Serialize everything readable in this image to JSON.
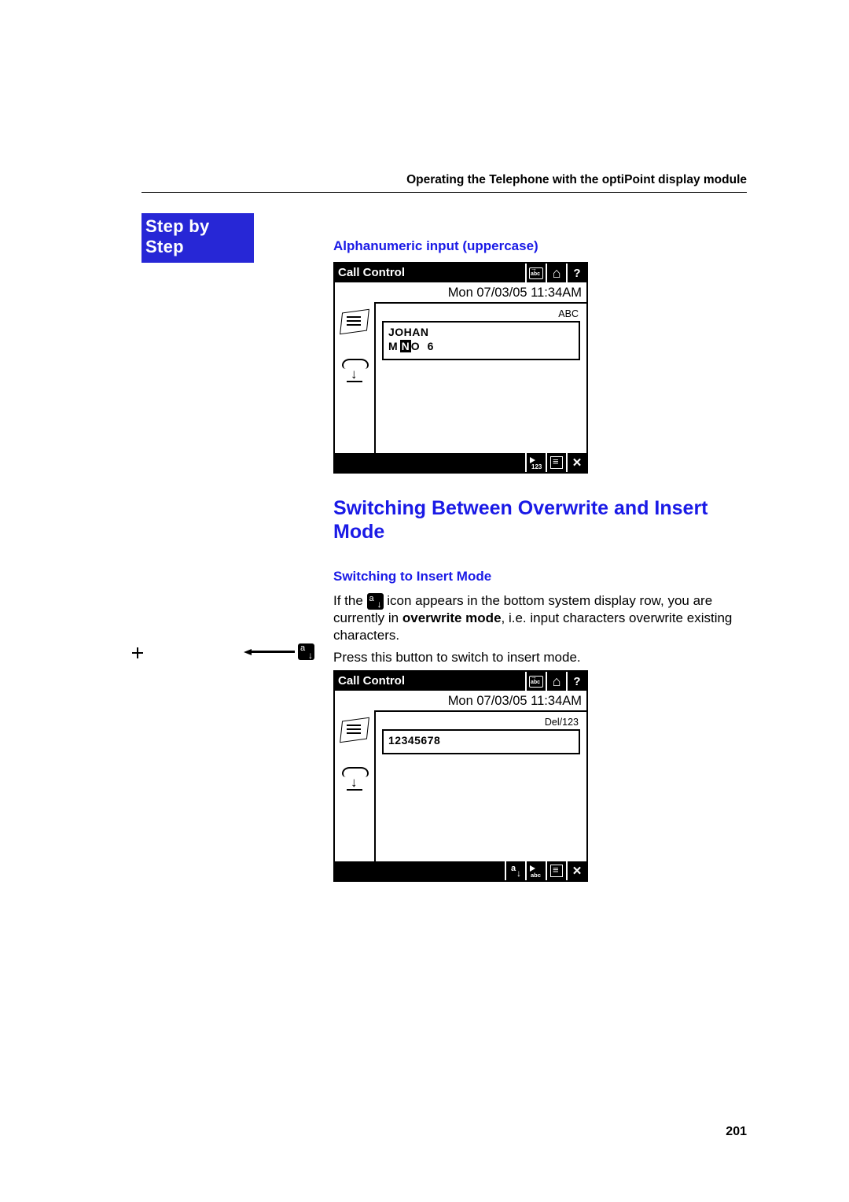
{
  "running_header": "Operating the Telephone with the optiPoint display module",
  "sidebar": {
    "step_label": "Step by Step"
  },
  "section1": {
    "label": "Alphanumeric input (uppercase)",
    "phone": {
      "title": "Call Control",
      "datetime": "Mon 07/03/05 11:34AM",
      "mode_indicator": "ABC",
      "line1": "JOHAN",
      "line2_pre": "M",
      "line2_cursor": "N",
      "line2_post": "O 6",
      "top_icons": [
        "keyboard-abc-icon",
        "home-icon",
        "help-icon"
      ],
      "bottom_icons": [
        "to-123-icon",
        "list-icon",
        "close-icon"
      ]
    }
  },
  "h2": "Switching Between Overwrite and Insert Mode",
  "section2": {
    "label": "Switching to Insert Mode",
    "para1_a": "If the ",
    "para1_b": " icon appears in the bottom system display row, you are currently in ",
    "para1_bold": "overwrite mode",
    "para1_c": ", i.e. input characters overwrite existing characters.",
    "para2": "Press this button to switch to insert mode.",
    "phone": {
      "title": "Call Control",
      "datetime": "Mon 07/03/05 11:34AM",
      "mode_indicator": "Del/123",
      "line1": "12345678",
      "top_icons": [
        "keyboard-abc-icon",
        "home-icon",
        "help-icon"
      ],
      "bottom_icons": [
        "overwrite-icon",
        "to-abc-icon",
        "list-icon",
        "close-icon"
      ]
    }
  },
  "page_number": "201"
}
